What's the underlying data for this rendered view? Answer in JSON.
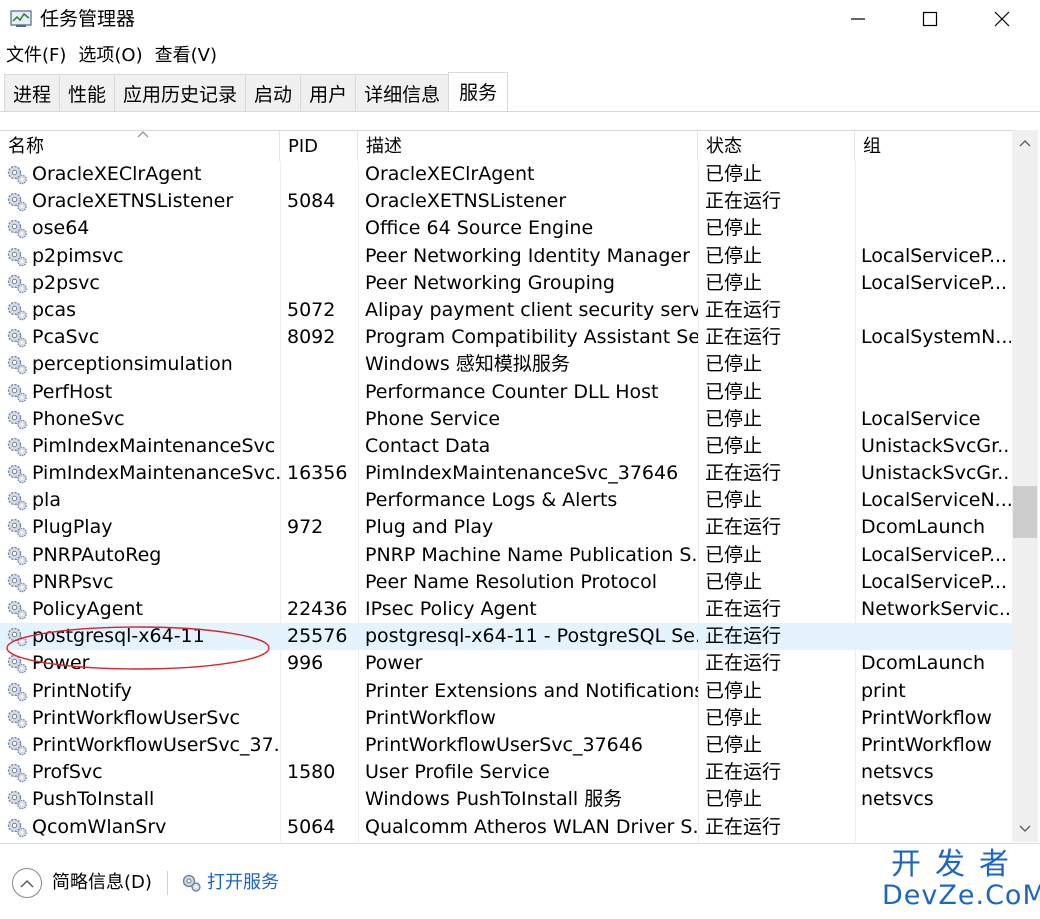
{
  "window": {
    "title": "任务管理器",
    "minimize_icon": "minimize-icon",
    "maximize_icon": "maximize-icon",
    "close_icon": "close-icon"
  },
  "menu": [
    "文件(F)",
    "选项(O)",
    "查看(V)"
  ],
  "tabs": [
    {
      "label": "进程"
    },
    {
      "label": "性能"
    },
    {
      "label": "应用历史记录"
    },
    {
      "label": "启动"
    },
    {
      "label": "用户"
    },
    {
      "label": "详细信息"
    },
    {
      "label": "服务",
      "active": true
    }
  ],
  "table": {
    "columns": [
      "名称",
      "PID",
      "描述",
      "状态",
      "组"
    ],
    "sorted_column": "名称",
    "rows": [
      {
        "name": "OracleXEClrAgent",
        "pid": "",
        "desc": "OracleXEClrAgent",
        "status": "已停止",
        "group": ""
      },
      {
        "name": "OracleXETNSListener",
        "pid": "5084",
        "desc": "OracleXETNSListener",
        "status": "正在运行",
        "group": ""
      },
      {
        "name": "ose64",
        "pid": "",
        "desc": "Office 64 Source Engine",
        "status": "已停止",
        "group": ""
      },
      {
        "name": "p2pimsvc",
        "pid": "",
        "desc": "Peer Networking Identity Manager",
        "status": "已停止",
        "group": "LocalServiceP..."
      },
      {
        "name": "p2psvc",
        "pid": "",
        "desc": "Peer Networking Grouping",
        "status": "已停止",
        "group": "LocalServiceP..."
      },
      {
        "name": "pcas",
        "pid": "5072",
        "desc": "Alipay payment client security servi...",
        "status": "正在运行",
        "group": ""
      },
      {
        "name": "PcaSvc",
        "pid": "8092",
        "desc": "Program Compatibility Assistant Se...",
        "status": "正在运行",
        "group": "LocalSystemN..."
      },
      {
        "name": "perceptionsimulation",
        "pid": "",
        "desc": "Windows 感知模拟服务",
        "status": "已停止",
        "group": ""
      },
      {
        "name": "PerfHost",
        "pid": "",
        "desc": "Performance Counter DLL Host",
        "status": "已停止",
        "group": ""
      },
      {
        "name": "PhoneSvc",
        "pid": "",
        "desc": "Phone Service",
        "status": "已停止",
        "group": "LocalService"
      },
      {
        "name": "PimIndexMaintenanceSvc",
        "pid": "",
        "desc": "Contact Data",
        "status": "已停止",
        "group": "UnistackSvcGr..."
      },
      {
        "name": "PimIndexMaintenanceSvc...",
        "pid": "16356",
        "desc": "PimIndexMaintenanceSvc_37646",
        "status": "正在运行",
        "group": "UnistackSvcGr..."
      },
      {
        "name": "pla",
        "pid": "",
        "desc": "Performance Logs & Alerts",
        "status": "已停止",
        "group": "LocalServiceN..."
      },
      {
        "name": "PlugPlay",
        "pid": "972",
        "desc": "Plug and Play",
        "status": "正在运行",
        "group": "DcomLaunch"
      },
      {
        "name": "PNRPAutoReg",
        "pid": "",
        "desc": "PNRP Machine Name Publication S...",
        "status": "已停止",
        "group": "LocalServiceP..."
      },
      {
        "name": "PNRPsvc",
        "pid": "",
        "desc": "Peer Name Resolution Protocol",
        "status": "已停止",
        "group": "LocalServiceP..."
      },
      {
        "name": "PolicyAgent",
        "pid": "22436",
        "desc": "IPsec Policy Agent",
        "status": "正在运行",
        "group": "NetworkServic..."
      },
      {
        "name": "postgresql-x64-11",
        "pid": "25576",
        "desc": "postgresql-x64-11 - PostgreSQL Se...",
        "status": "正在运行",
        "group": "",
        "highlighted": true
      },
      {
        "name": "Power",
        "pid": "996",
        "desc": "Power",
        "status": "正在运行",
        "group": "DcomLaunch"
      },
      {
        "name": "PrintNotify",
        "pid": "",
        "desc": "Printer Extensions and Notifications",
        "status": "已停止",
        "group": "print"
      },
      {
        "name": "PrintWorkflowUserSvc",
        "pid": "",
        "desc": "PrintWorkflow",
        "status": "已停止",
        "group": "PrintWorkflow"
      },
      {
        "name": "PrintWorkflowUserSvc_37...",
        "pid": "",
        "desc": "PrintWorkflowUserSvc_37646",
        "status": "已停止",
        "group": "PrintWorkflow"
      },
      {
        "name": "ProfSvc",
        "pid": "1580",
        "desc": "User Profile Service",
        "status": "正在运行",
        "group": "netsvcs"
      },
      {
        "name": "PushToInstall",
        "pid": "",
        "desc": "Windows PushToInstall 服务",
        "status": "已停止",
        "group": "netsvcs"
      },
      {
        "name": "QcomWlanSrv",
        "pid": "5064",
        "desc": "Qualcomm Atheros WLAN Driver S...",
        "status": "正在运行",
        "group": ""
      }
    ]
  },
  "footer": {
    "brief_label": "简略信息(D)",
    "open_services_label": "打开服务"
  },
  "watermark": {
    "top": "开发者",
    "bottom": "DevZe.CoM"
  },
  "colors": {
    "highlight_row": "#e5f3ff",
    "link": "#1a64c8",
    "annotation": "#d8262c",
    "watermark": "#1e66c4"
  }
}
